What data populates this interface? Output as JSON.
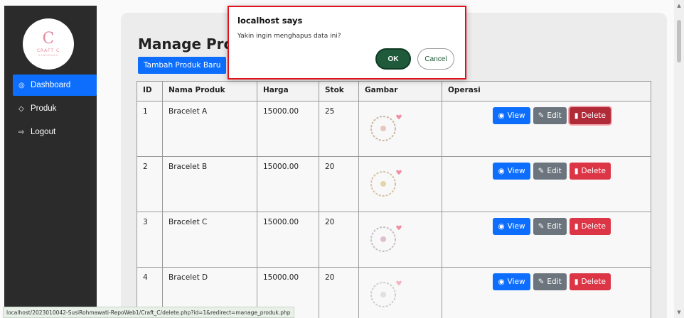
{
  "sidebar": {
    "logo": {
      "mark": "C",
      "brand": "CRAFT C",
      "sub": "HANDMADE"
    },
    "items": [
      {
        "icon": "dashboard-icon",
        "glyph": "◎",
        "label": "Dashboard",
        "active": true
      },
      {
        "icon": "box-icon",
        "glyph": "◇",
        "label": "Produk",
        "active": false
      },
      {
        "icon": "logout-icon",
        "glyph": "⇨",
        "label": "Logout",
        "active": false
      }
    ]
  },
  "page": {
    "title": "Manage Produk",
    "add_label": "Tambah Produk Baru"
  },
  "table": {
    "headers": [
      "ID",
      "Nama Produk",
      "Harga",
      "Stok",
      "Gambar",
      "Operasi"
    ],
    "rows": [
      {
        "id": "1",
        "name": "Bracelet A",
        "price": "15000.00",
        "stok": "25"
      },
      {
        "id": "2",
        "name": "Bracelet B",
        "price": "15000.00",
        "stok": "20"
      },
      {
        "id": "3",
        "name": "Bracelet C",
        "price": "15000.00",
        "stok": "20"
      },
      {
        "id": "4",
        "name": "Bracelet D",
        "price": "15000.00",
        "stok": "20"
      }
    ],
    "ops": {
      "view": "View",
      "edit": "Edit",
      "delete": "Delete"
    }
  },
  "dialog": {
    "title": "localhost says",
    "message": "Yakin ingin menghapus data ini?",
    "ok": "OK",
    "cancel": "Cancel"
  },
  "status_url": "localhost/2023010042-SusiRohmawati-RepoWeb1/Craft_C/delete.php?id=1&redirect=manage_produk.php",
  "colors": {
    "primary": "#0d6efd",
    "secondary": "#6c757d",
    "danger": "#dc3545",
    "sidebar": "#2b2b2b",
    "dialog_border": "#e0111a"
  }
}
